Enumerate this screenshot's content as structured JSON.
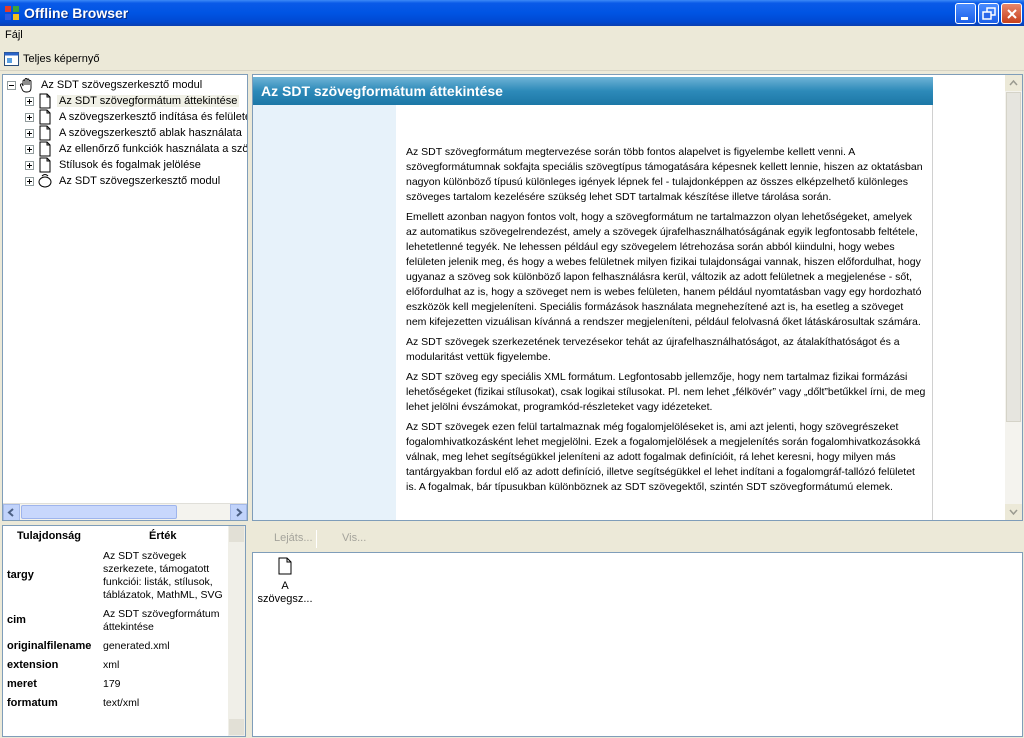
{
  "window": {
    "title": "Offline Browser"
  },
  "menu": {
    "file": "Fájl"
  },
  "toolbar": {
    "fullscreen_label": "Teljes képernyő"
  },
  "tree": {
    "root": "Az SDT szövegszerkesztő modul",
    "items": [
      {
        "label": "Az SDT szövegformátum áttekintése",
        "selected": true
      },
      {
        "label": "A szövegszerkesztő indítása és felülete"
      },
      {
        "label": "A szövegszerkesztő ablak használata"
      },
      {
        "label": "Az ellenőrző funkciók használata a szövegszerkesztőben"
      },
      {
        "label": "Stílusok és fogalmak jelölése"
      },
      {
        "label": "Az SDT szövegszerkesztő modul"
      }
    ]
  },
  "properties": {
    "header_key": "Tulajdonság",
    "header_value": "Érték",
    "rows": [
      {
        "key": "targy",
        "value": "Az SDT szövegek szerkezete, támogatott funkciói: listák, stílusok, táblázatok, MathML, SVG"
      },
      {
        "key": "cim",
        "value": "Az SDT szövegformátum áttekintése"
      },
      {
        "key": "originalfilename",
        "value": "generated.xml"
      },
      {
        "key": "extension",
        "value": "xml"
      },
      {
        "key": "meret",
        "value": "179"
      },
      {
        "key": "formatum",
        "value": "text/xml"
      }
    ]
  },
  "content": {
    "title": "Az SDT szövegformátum áttekintése",
    "paragraphs": [
      "Az SDT szövegformátum megtervezése során több fontos alapelvet is figyelembe kellett venni. A szövegformátumnak sokfajta speciális szövegtípus támogatására képesnek kellett lennie, hiszen az oktatásban nagyon különböző típusú különleges igények lépnek fel - tulajdonképpen az összes elképzelhető különleges szöveges tartalom kezelésére szükség lehet SDT tartalmak készítése illetve tárolása során.",
      "Emellett azonban nagyon fontos volt, hogy a szövegformátum ne tartalmazzon olyan lehetőségeket, amelyek az automatikus szövegelrendezést, amely a szövegek újrafelhasználhatóságának egyik legfontosabb feltétele, lehetetlenné tegyék. Ne lehessen például egy szövegelem létrehozása során abból kiindulni, hogy webes felületen jelenik meg, és hogy a webes felületnek milyen fizikai tulajdonságai vannak, hiszen előfordulhat, hogy ugyanaz a szöveg sok különböző lapon felhasználásra kerül, változik az adott felületnek a megjelenése - sőt, előfordulhat az is, hogy a szöveget nem is webes felületen, hanem például nyomtatásban vagy egy hordozható eszközök kell megjeleníteni. Speciális formázások használata megnehezítené azt is, ha esetleg a szöveget nem kifejezetten vizuálisan kívánná a rendszer megjeleníteni, például felolvasná őket látáskárosultak számára.",
      "Az SDT szövegek szerkezetének tervezésekor tehát az újrafelhasználhatóságot, az átalakíthatóságot és a modularitást vettük figyelembe.",
      "Az SDT szöveg egy speciális XML formátum. Legfontosabb jellemzője, hogy nem tartalmaz fizikai formázási lehetőségeket (fizikai stílusokat), csak logikai stílusokat. Pl. nem lehet „félkövér” vagy „dőlt”betűkkel írni, de meg lehet jelölni évszámokat, programkód-részleteket vagy idézeteket.",
      "Az SDT szövegek ezen felül tartalmaznak még fogalomjelöléseket is, ami azt jelenti, hogy szövegrészeket fogalomhivatkozásként lehet megjelölni. Ezek a fogalomjelölések a megjelenítés során fogalomhivatkozásokká válnak, meg lehet segítségükkel jeleníteni az adott fogalmak definícióit, rá lehet keresni, hogy milyen más tantárgyakban fordul elő az adott definíció, illetve segítségükkel el lehet indítani a fogalomgráf-tallózó felületet is. A fogalmak, bár típusukban különböznek az SDT szövegektől, szintén SDT szövegformátumú elemek."
    ]
  },
  "bottom_toolbar": {
    "play_label": "Lejáts...",
    "view_label": "Vis..."
  },
  "files": {
    "items": [
      {
        "name": "A szövegsz..."
      }
    ]
  }
}
